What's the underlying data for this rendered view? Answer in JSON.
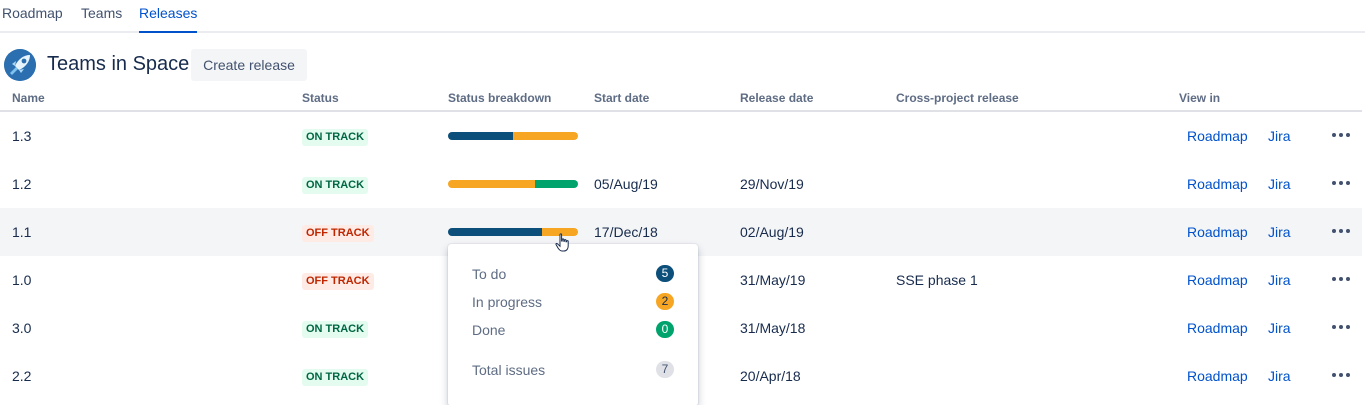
{
  "nav": {
    "tabs": [
      {
        "label": "Roadmap",
        "active": false
      },
      {
        "label": "Teams",
        "active": false
      },
      {
        "label": "Releases",
        "active": true
      }
    ]
  },
  "header": {
    "project_name": "Teams in Space",
    "create_button": "Create release",
    "logo_icon": "rocket-icon"
  },
  "table": {
    "columns": [
      "Name",
      "Status",
      "Status breakdown",
      "Start date",
      "Release date",
      "Cross-project release",
      "View in"
    ],
    "rows": [
      {
        "name": "1.3",
        "status": "ON TRACK",
        "status_kind": "on",
        "breakdown": [
          0.5,
          0.5,
          0.0
        ],
        "start_date": "",
        "release_date": "",
        "cross_project": "",
        "roadmap": "Roadmap",
        "jira": "Jira"
      },
      {
        "name": "1.2",
        "status": "ON TRACK",
        "status_kind": "on",
        "breakdown": [
          0.0,
          0.67,
          0.33
        ],
        "start_date": "05/Aug/19",
        "release_date": "29/Nov/19",
        "cross_project": "",
        "roadmap": "Roadmap",
        "jira": "Jira"
      },
      {
        "name": "1.1",
        "status": "OFF TRACK",
        "status_kind": "off",
        "breakdown": [
          0.72,
          0.28,
          0.0
        ],
        "start_date": "17/Dec/18",
        "release_date": "02/Aug/19",
        "cross_project": "",
        "roadmap": "Roadmap",
        "jira": "Jira",
        "highlighted": true
      },
      {
        "name": "1.0",
        "status": "OFF TRACK",
        "status_kind": "off",
        "breakdown": null,
        "start_date": "",
        "release_date": "31/May/19",
        "cross_project": "SSE phase 1",
        "roadmap": "Roadmap",
        "jira": "Jira"
      },
      {
        "name": "3.0",
        "status": "ON TRACK",
        "status_kind": "on",
        "breakdown": null,
        "start_date": "",
        "release_date": "31/May/18",
        "cross_project": "",
        "roadmap": "Roadmap",
        "jira": "Jira"
      },
      {
        "name": "2.2",
        "status": "ON TRACK",
        "status_kind": "on",
        "breakdown": null,
        "start_date": "",
        "release_date": "20/Apr/18",
        "cross_project": "",
        "roadmap": "Roadmap",
        "jira": "Jira"
      }
    ]
  },
  "popup": {
    "items": [
      {
        "label": "To do",
        "count": "5",
        "color": "#0b4f7a",
        "text_color": "#ffffff"
      },
      {
        "label": "In progress",
        "count": "2",
        "color": "#f6a623",
        "text_color": "#172b4d"
      },
      {
        "label": "Done",
        "count": "0",
        "color": "#00a36c",
        "text_color": "#ffffff"
      }
    ],
    "total_label": "Total issues",
    "total_count": "7"
  },
  "colors": {
    "todo": "#0b4f7a",
    "in_progress": "#f6a623",
    "done": "#00a36c",
    "link": "#0052cc"
  }
}
